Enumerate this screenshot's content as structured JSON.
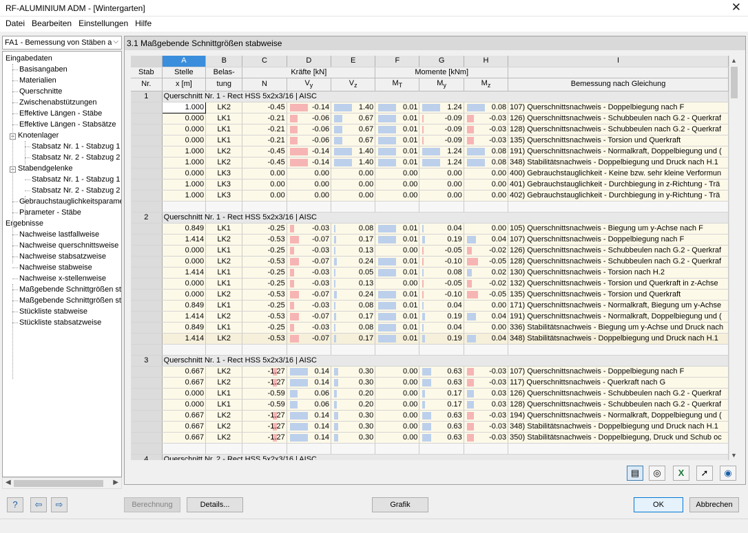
{
  "window": {
    "title": "RF-ALUMINIUM ADM - [Wintergarten]",
    "close": "✕"
  },
  "menu": [
    "Datei",
    "Bearbeiten",
    "Einstellungen",
    "Hilfe"
  ],
  "case_select": "FA1 - Bemessung von Stäben a",
  "tree": [
    {
      "label": "Eingabedaten",
      "level": 0
    },
    {
      "label": "Basisangaben",
      "level": 1
    },
    {
      "label": "Materialien",
      "level": 1
    },
    {
      "label": "Querschnitte",
      "level": 1
    },
    {
      "label": "Zwischenabstützungen",
      "level": 1
    },
    {
      "label": "Effektive Längen - Stäbe",
      "level": 1
    },
    {
      "label": "Effektive Längen - Stabsätze",
      "level": 1
    },
    {
      "label": "Knotenlager",
      "level": 1,
      "toggle": "−"
    },
    {
      "label": "Stabsatz Nr. 1 - Stabzug 1",
      "level": 2
    },
    {
      "label": "Stabsatz Nr. 2 - Stabzug 2",
      "level": 2
    },
    {
      "label": "Stabendgelenke",
      "level": 1,
      "toggle": "−"
    },
    {
      "label": "Stabsatz Nr. 1 - Stabzug 1",
      "level": 2
    },
    {
      "label": "Stabsatz Nr. 2 - Stabzug 2",
      "level": 2
    },
    {
      "label": "Gebrauchstauglichkeitsparamet",
      "level": 1
    },
    {
      "label": "Parameter - Stäbe",
      "level": 1
    },
    {
      "label": "Ergebnisse",
      "level": 0
    },
    {
      "label": "Nachweise lastfallweise",
      "level": 1
    },
    {
      "label": "Nachweise querschnittsweise",
      "level": 1
    },
    {
      "label": "Nachweise stabsatzweise",
      "level": 1
    },
    {
      "label": "Nachweise stabweise",
      "level": 1
    },
    {
      "label": "Nachweise x-stellenweise",
      "level": 1
    },
    {
      "label": "Maßgebende Schnittgrößen sta",
      "level": 1
    },
    {
      "label": "Maßgebende Schnittgrößen sta",
      "level": 1
    },
    {
      "label": "Stückliste stabweise",
      "level": 1
    },
    {
      "label": "Stückliste stabsatzweise",
      "level": 1
    }
  ],
  "panel_title": "3.1 Maßgebende Schnittgrößen stabweise",
  "columns": {
    "letters": [
      "A",
      "B",
      "C",
      "D",
      "E",
      "F",
      "G",
      "H",
      "I"
    ],
    "stab": [
      "Stab",
      "Nr."
    ],
    "stelle": [
      "Stelle",
      "x [m]"
    ],
    "belastung": [
      "Belas-",
      "tung"
    ],
    "kraefte": "Kräfte [kN]",
    "momente": "Momente [kNm]",
    "sub": [
      "N",
      "Vy",
      "Vz",
      "MT",
      "My",
      "Mz"
    ],
    "bemessung": "Bemessung nach Gleichung"
  },
  "max": {
    "N": 1.27,
    "Vy": 0.14,
    "Vz": 1.4,
    "MT": 0.01,
    "My": 1.24,
    "Mz": 0.08
  },
  "sections": [
    {
      "nr": "1",
      "title": "Querschnitt Nr.  1 - Rect HSS 5x2x3/16 | AISC",
      "rows": [
        [
          "1.000",
          "LK2",
          "-0.45",
          "-0.14",
          "1.40",
          "0.01",
          "1.24",
          "0.08",
          "107) Querschnittsnachweis - Doppelbiegung nach F"
        ],
        [
          "0.000",
          "LK1",
          "-0.21",
          "-0.06",
          "0.67",
          "0.01",
          "-0.09",
          "-0.03",
          "126) Querschnittsnachweis - Schubbeulen nach G.2 - Querkraf"
        ],
        [
          "0.000",
          "LK1",
          "-0.21",
          "-0.06",
          "0.67",
          "0.01",
          "-0.09",
          "-0.03",
          "128) Querschnittsnachweis - Schubbeulen nach G.2 - Querkraf"
        ],
        [
          "0.000",
          "LK1",
          "-0.21",
          "-0.06",
          "0.67",
          "0.01",
          "-0.09",
          "-0.03",
          "135) Querschnittsnachweis - Torsion und Querkraft"
        ],
        [
          "1.000",
          "LK2",
          "-0.45",
          "-0.14",
          "1.40",
          "0.01",
          "1.24",
          "0.08",
          "191) Querschnittsnachweis - Normalkraft, Doppelbiegung und ("
        ],
        [
          "1.000",
          "LK2",
          "-0.45",
          "-0.14",
          "1.40",
          "0.01",
          "1.24",
          "0.08",
          "348) Stabilitätsnachweis - Doppelbiegung und Druck nach H.1"
        ],
        [
          "0.000",
          "LK3",
          "0.00",
          "0.00",
          "0.00",
          "0.00",
          "0.00",
          "0.00",
          "400) Gebrauchstauglichkeit - Keine bzw. sehr kleine Verformun"
        ],
        [
          "1.000",
          "LK3",
          "0.00",
          "0.00",
          "0.00",
          "0.00",
          "0.00",
          "0.00",
          "401) Gebrauchstauglichkeit - Durchbiegung in z-Richtung - Trä"
        ],
        [
          "1.000",
          "LK3",
          "0.00",
          "0.00",
          "0.00",
          "0.00",
          "0.00",
          "0.00",
          "402) Gebrauchstauglichkeit - Durchbiegung in y-Richtung - Trä"
        ]
      ]
    },
    {
      "nr": "2",
      "title": "Querschnitt Nr.  1 - Rect HSS 5x2x3/16 | AISC",
      "rows": [
        [
          "0.849",
          "LK1",
          "-0.25",
          "-0.03",
          "0.08",
          "0.01",
          "0.04",
          "0.00",
          "105) Querschnittsnachweis - Biegung um y-Achse nach F"
        ],
        [
          "1.414",
          "LK2",
          "-0.53",
          "-0.07",
          "0.17",
          "0.01",
          "0.19",
          "0.04",
          "107) Querschnittsnachweis - Doppelbiegung nach F"
        ],
        [
          "0.000",
          "LK1",
          "-0.25",
          "-0.03",
          "0.13",
          "0.00",
          "-0.05",
          "-0.02",
          "126) Querschnittsnachweis - Schubbeulen nach G.2 - Querkraf"
        ],
        [
          "0.000",
          "LK2",
          "-0.53",
          "-0.07",
          "0.24",
          "0.01",
          "-0.10",
          "-0.05",
          "128) Querschnittsnachweis - Schubbeulen nach G.2 - Querkraf"
        ],
        [
          "1.414",
          "LK1",
          "-0.25",
          "-0.03",
          "0.05",
          "0.01",
          "0.08",
          "0.02",
          "130) Querschnittsnachweis - Torsion nach H.2"
        ],
        [
          "0.000",
          "LK1",
          "-0.25",
          "-0.03",
          "0.13",
          "0.00",
          "-0.05",
          "-0.02",
          "132) Querschnittsnachweis - Torsion und Querkraft in z-Achse"
        ],
        [
          "0.000",
          "LK2",
          "-0.53",
          "-0.07",
          "0.24",
          "0.01",
          "-0.10",
          "-0.05",
          "135) Querschnittsnachweis - Torsion und Querkraft"
        ],
        [
          "0.849",
          "LK1",
          "-0.25",
          "-0.03",
          "0.08",
          "0.01",
          "0.04",
          "0.00",
          "171) Querschnittsnachweis - Normalkraft, Biegung um y-Achse"
        ],
        [
          "1.414",
          "LK2",
          "-0.53",
          "-0.07",
          "0.17",
          "0.01",
          "0.19",
          "0.04",
          "191) Querschnittsnachweis - Normalkraft, Doppelbiegung und ("
        ],
        [
          "0.849",
          "LK1",
          "-0.25",
          "-0.03",
          "0.08",
          "0.01",
          "0.04",
          "0.00",
          "336) Stabilitätsnachweis - Biegung um y-Achse und Druck nach"
        ],
        [
          "1.414",
          "LK2",
          "-0.53",
          "-0.07",
          "0.17",
          "0.01",
          "0.19",
          "0.04",
          "348) Stabilitätsnachweis - Doppelbiegung und Druck nach H.1"
        ]
      ]
    },
    {
      "nr": "3",
      "title": "Querschnitt Nr.  1 - Rect HSS 5x2x3/16 | AISC",
      "rows": [
        [
          "0.667",
          "LK2",
          "-1.27",
          "0.14",
          "0.30",
          "0.00",
          "0.63",
          "-0.03",
          "107) Querschnittsnachweis - Doppelbiegung nach F"
        ],
        [
          "0.667",
          "LK2",
          "-1.27",
          "0.14",
          "0.30",
          "0.00",
          "0.63",
          "-0.03",
          "117) Querschnittsnachweis - Querkraft nach G"
        ],
        [
          "0.000",
          "LK1",
          "-0.59",
          "0.06",
          "0.20",
          "0.00",
          "0.17",
          "0.03",
          "126) Querschnittsnachweis - Schubbeulen nach G.2 - Querkraf"
        ],
        [
          "0.000",
          "LK1",
          "-0.59",
          "0.06",
          "0.20",
          "0.00",
          "0.17",
          "0.03",
          "128) Querschnittsnachweis - Schubbeulen nach G.2 - Querkraf"
        ],
        [
          "0.667",
          "LK2",
          "-1.27",
          "0.14",
          "0.30",
          "0.00",
          "0.63",
          "-0.03",
          "194) Querschnittsnachweis - Normalkraft, Doppelbiegung und ("
        ],
        [
          "0.667",
          "LK2",
          "-1.27",
          "0.14",
          "0.30",
          "0.00",
          "0.63",
          "-0.03",
          "348) Stabilitätsnachweis - Doppelbiegung und Druck nach H.1"
        ],
        [
          "0.667",
          "LK2",
          "-1.27",
          "0.14",
          "0.30",
          "0.00",
          "0.63",
          "-0.03",
          "350) Stabilitätsnachweis - Doppelbiegung, Druck und Schub oc"
        ]
      ]
    },
    {
      "nr": "4",
      "title": "Querschnitt Nr.  2 - Rect HSS 5x2x3/16 | AISC",
      "rows": []
    }
  ],
  "toolbar_icons": [
    "table-select-icon",
    "color-scale-icon",
    "excel-export-icon",
    "pointer-icon",
    "eye-icon"
  ],
  "buttons": {
    "berechnung": "Berechnung",
    "details": "Details...",
    "grafik": "Grafik",
    "ok": "OK",
    "abbrechen": "Abbrechen"
  },
  "bottom_icons": [
    "help-icon",
    "previous-icon",
    "next-icon"
  ]
}
